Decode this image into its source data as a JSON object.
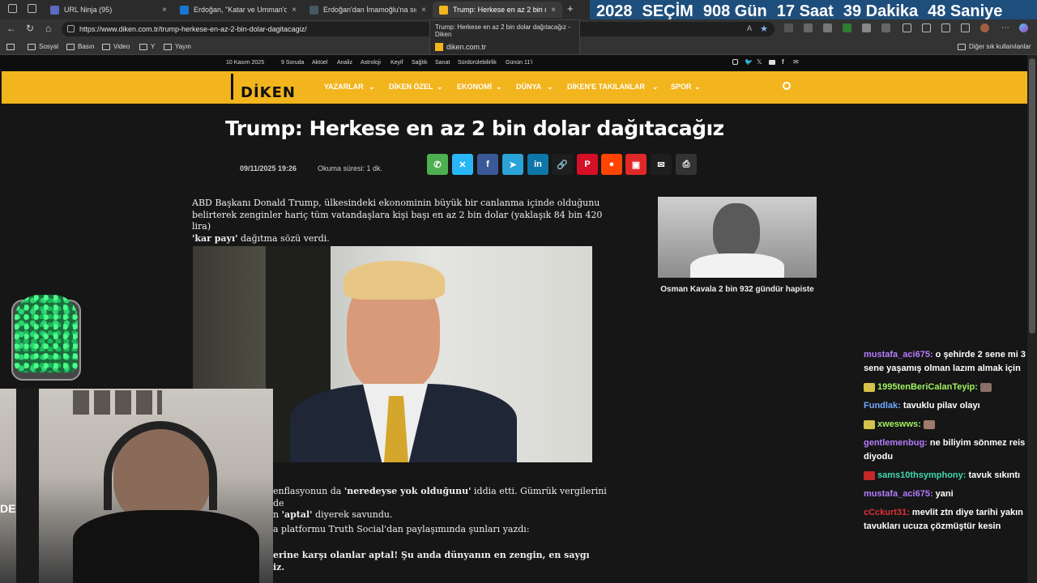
{
  "browser": {
    "tabs": [
      {
        "label": "URL Ninja (95)",
        "close": "×",
        "fav_color": "#5c6bc0"
      },
      {
        "label": "Erdoğan, \"Katar ve Umman'dan d",
        "close": "×",
        "fav_color": "#1976d2"
      },
      {
        "label": "Erdoğan'dan İmamoğlu'na sığınm",
        "close": "×",
        "fav_color": "#455a64"
      },
      {
        "label": "Trump: Herkese en az 2 bin dolar",
        "close": "×",
        "fav_color": "#f2b51d"
      }
    ],
    "new_tab": "+",
    "url": "https://www.diken.com.tr/trump-herkese-en-az-2-bin-dolar-dagitacagiz/",
    "tooltip": {
      "title": "Trump: Herkese en az 2 bin dolar dağıtacağız - Diken",
      "domain": "diken.com.tr"
    },
    "bookmarks": [
      "Sosyal",
      "Basın",
      "Video",
      "Y",
      "Yayın"
    ],
    "bookmarks_other": "Diğer sık kullanılanlar",
    "nav": {
      "back": "←",
      "reload": "↻",
      "home": "⌂"
    }
  },
  "countdown": {
    "year": "2028",
    "label": "SEÇİM",
    "days": "908 Gün",
    "hours": "17 Saat",
    "minutes": "39 Dakika",
    "seconds": "48 Saniye"
  },
  "site": {
    "date": "10 Kasım 2025",
    "toplinks": [
      "9 Soruda",
      "Aktüel",
      "Analiz",
      "Astroloji",
      "Keyif",
      "Sağlık",
      "Sanat",
      "Sürdürülebilirlik",
      "Günün 11'i"
    ],
    "logo": "DİKEN",
    "nav": [
      "YAZARLAR",
      "DİKEN ÖZEL",
      "EKONOMİ",
      "DÜNYA",
      "DİKEN'E TAKILANLAR",
      "SPOR"
    ],
    "article": {
      "title": "Trump: Herkese en az 2 bin dolar dağıtacağız",
      "datetime": "09/11/2025 19:26",
      "read_time": "Okuma süresi: 1 dk.",
      "p1_line1": "ABD Başkanı Donald Trump, ülkesindeki ekonominin büyük bir canlanma içinde olduğunu",
      "p1_line2": "belirterek zenginler hariç tüm vatandaşlara kişi başı en az 2 bin dolar (yaklaşık 84 bin 420 lira)",
      "p1_bold": "'kar payı'",
      "p1_tail": " dağıtma sözü verdi.",
      "p2_a": "enflasyonun da ",
      "p2_b": "'neredeyse yok olduğunu'",
      "p2_c": " iddia etti. Gümrük vergilerini de",
      "p2_d": "n ",
      "p2_e": "'aptal'",
      "p2_f": " diyerek savundu.",
      "p3": "a platformu Truth Social'dan paylaşımında şunları yazdı:",
      "p4_1": "erine karşı olanlar aptal! Şu anda dünyanın en zengin, en saygı",
      "p4_2": "iz."
    },
    "sidebar": {
      "caption": "Osman Kavala 2 bin 932 gündür hapiste"
    }
  },
  "chat": [
    {
      "user": "mustafa_aci675:",
      "color": "#b57cff",
      "msg": " o şehirde 2 sene mi 3 sene yaşamış olman lazım almak için"
    },
    {
      "user": "1995tenBeriCalanTeyip:",
      "color": "#9ff25e",
      "msg": ""
    },
    {
      "user": "Fundlak:",
      "color": "#6fa8ff",
      "msg": " tavuklu pilav olayı"
    },
    {
      "user": "xweswws:",
      "color": "#9ff25e",
      "msg": ""
    },
    {
      "user": "gentlemenbug:",
      "color": "#b57cff",
      "msg": " ne biliyim sönmez reis diyodu"
    },
    {
      "user": "sams10thsymphony:",
      "color": "#3fd8b0",
      "msg": " tavuk sıkıntı"
    },
    {
      "user": "mustafa_aci675:",
      "color": "#b57cff",
      "msg": " yani"
    },
    {
      "user": "cCckurt31:",
      "color": "#e0303a",
      "msg": " mevlit ztn diye tarihi yakın tavukları ucuza çözmüştür kesin"
    }
  ],
  "webcam_overlay": "DE"
}
